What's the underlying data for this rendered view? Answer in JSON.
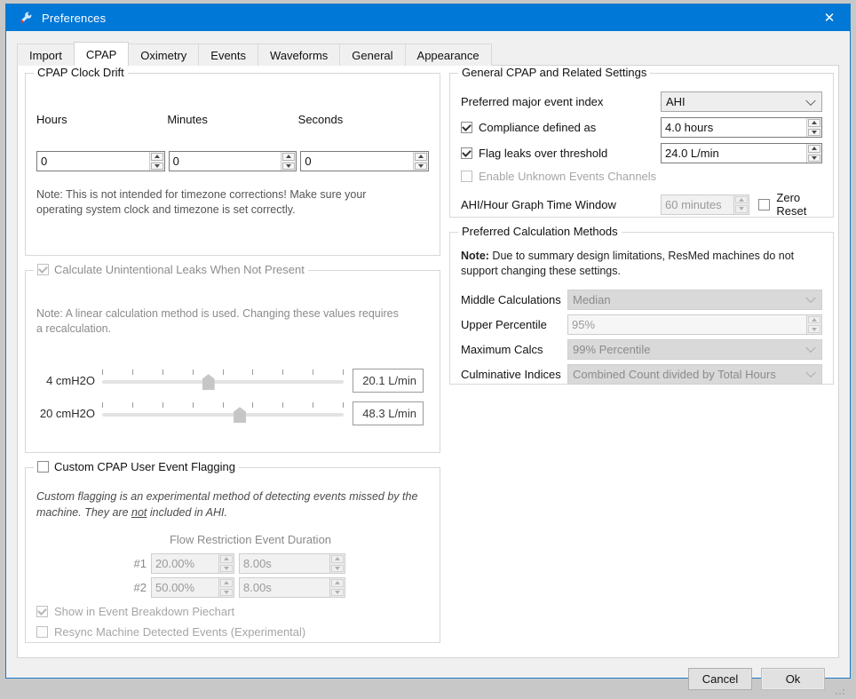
{
  "window": {
    "title": "Preferences",
    "icon": "wrench-icon",
    "close_label": "✕",
    "accent_color": "#0078d7"
  },
  "tabs": [
    {
      "label": "Import",
      "active": false
    },
    {
      "label": "CPAP",
      "active": true
    },
    {
      "label": "Oximetry",
      "active": false
    },
    {
      "label": "Events",
      "active": false
    },
    {
      "label": "Waveforms",
      "active": false
    },
    {
      "label": "General",
      "active": false
    },
    {
      "label": "Appearance",
      "active": false
    }
  ],
  "clock_drift": {
    "legend": "CPAP Clock Drift",
    "headers": [
      "Hours",
      "Minutes",
      "Seconds"
    ],
    "values": [
      "0",
      "0",
      "0"
    ],
    "note": "Note: This is not intended for timezone corrections! Make sure your operating system clock and timezone is set correctly."
  },
  "leaks": {
    "legend": "Calculate Unintentional Leaks When Not Present",
    "checked": true,
    "note": "Note: A linear calculation method is used. Changing these values requires a recalculation.",
    "rows": [
      {
        "label": "4 cmH2O",
        "value": "20.1 L/min",
        "handle_pct": 44
      },
      {
        "label": "20 cmH2O",
        "value": "48.3 L/min",
        "handle_pct": 57
      }
    ]
  },
  "flagging": {
    "legend": "Custom CPAP User Event Flagging",
    "checked": false,
    "note_pre": "Custom flagging is an experimental method of detecting events missed by the machine. They are ",
    "note_underlined": "not",
    "note_post": " included in AHI.",
    "columns_header": "Flow Restriction Event Duration",
    "rows": [
      {
        "num": "#1",
        "restriction": "20.00%",
        "duration": "8.00s"
      },
      {
        "num": "#2",
        "restriction": "50.00%",
        "duration": "8.00s"
      }
    ],
    "piechart_label": "Show in Event Breakdown Piechart",
    "piechart_checked": true,
    "resync_label": "Resync Machine Detected Events (Experimental)",
    "resync_checked": false
  },
  "general": {
    "legend": "General CPAP and Related Settings",
    "major_index_label": "Preferred major event index",
    "major_index_value": "AHI",
    "compliance_label": "Compliance defined as",
    "compliance_checked": true,
    "compliance_value": "4.0 hours",
    "leak_flag_label": "Flag leaks over threshold",
    "leak_flag_checked": true,
    "leak_flag_value": "24.0 L/min",
    "unknown_events_label": "Enable Unknown Events Channels",
    "unknown_events_checked": false,
    "graph_window_label": "AHI/Hour Graph Time Window",
    "graph_window_value": "60 minutes",
    "zero_reset_label": "Zero Reset",
    "zero_reset_checked": false
  },
  "calc_methods": {
    "legend": "Preferred Calculation Methods",
    "note_bold": "Note:",
    "note_rest": " Due to summary design limitations, ResMed machines do not support changing these settings.",
    "rows": [
      {
        "label": "Middle Calculations",
        "value": "Median",
        "control": "combo"
      },
      {
        "label": "Upper Percentile",
        "value": "95%",
        "control": "spin"
      },
      {
        "label": "Maximum Calcs",
        "value": "99% Percentile",
        "control": "combo"
      },
      {
        "label": "Culminative Indices",
        "value": "Combined Count divided by Total Hours",
        "control": "combo"
      }
    ]
  },
  "footer": {
    "cancel_label": "Cancel",
    "ok_label": "Ok"
  }
}
